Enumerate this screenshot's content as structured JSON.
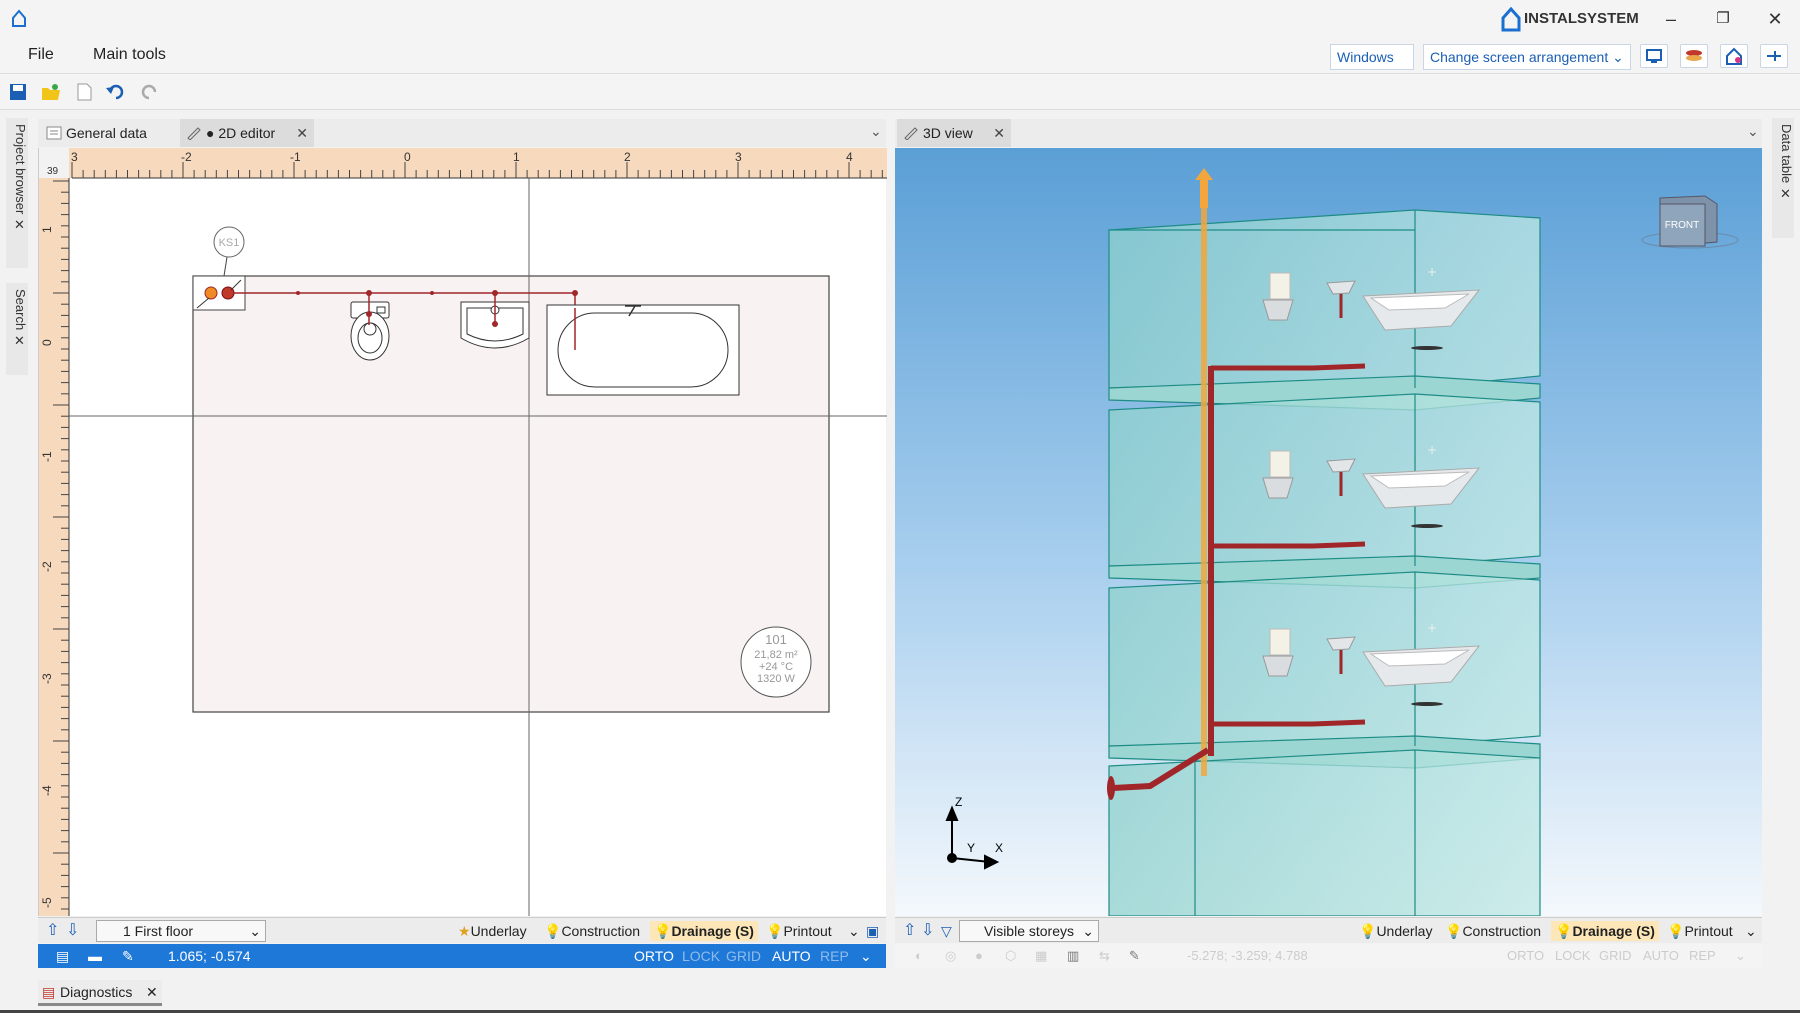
{
  "app": {
    "name": "INSTALSYSTEM"
  },
  "menu": {
    "file": "File",
    "main_tools": "Main tools"
  },
  "header_controls": {
    "windows": "Windows",
    "arrangement": "Change screen arrangement"
  },
  "side_tabs": {
    "project_browser": "Project browser",
    "search": "Search",
    "data_table": "Data table"
  },
  "editor2d": {
    "tabs": [
      {
        "label": "General data"
      },
      {
        "label": "● 2D editor"
      }
    ],
    "ruler_corner": "39",
    "ruler_top": [
      "3",
      "-2",
      "-1",
      "0",
      "1",
      "2",
      "3",
      "4"
    ],
    "ruler_left": [
      "1",
      "0",
      "-1",
      "-2",
      "-3",
      "-4",
      "-5"
    ],
    "tag_ks": "KS1",
    "room": {
      "number": "101",
      "area": "21,82 m²",
      "temp": "+24 °C",
      "power": "1320 W"
    },
    "floor": "1 First floor",
    "layers": [
      "Underlay",
      "Construction",
      "Drainage (S)",
      "Printout"
    ],
    "coords": "1.065; -0.574",
    "modes": [
      "ORTO",
      "LOCK",
      "GRID",
      "AUTO",
      "REP"
    ]
  },
  "view3d": {
    "tab": "3D view",
    "cube": "FRONT",
    "axes": {
      "z": "Z",
      "y": "Y",
      "x": "X"
    },
    "storeys_button": "Visible storeys",
    "layers": [
      "Underlay",
      "Construction",
      "Drainage (S)",
      "Printout"
    ],
    "coords": "-5.278; -3.259; 4.788",
    "modes": [
      "ORTO",
      "LOCK",
      "GRID",
      "AUTO",
      "REP"
    ]
  },
  "bottom": {
    "diagnostics": "Diagnostics"
  },
  "colors": {
    "accent": "#1e78d7",
    "pipe": "#a0262a",
    "riser": "#f3a63b",
    "floor_fill": "#a9dcd9"
  }
}
